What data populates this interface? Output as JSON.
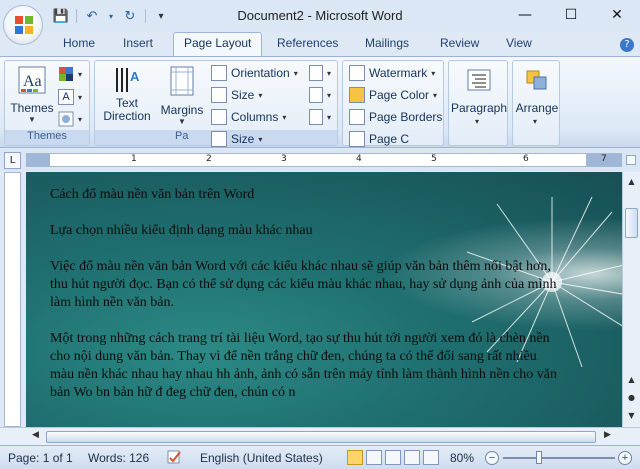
{
  "window": {
    "title": "Document2 - Microsoft Word",
    "minimize": "—",
    "maximize": "☐",
    "close": "✕"
  },
  "qat": {
    "save": "💾",
    "undo": "↶",
    "redo": "↻",
    "customize": "▾"
  },
  "tabs": [
    {
      "label": "Home"
    },
    {
      "label": "Insert"
    },
    {
      "label": "Page Layout"
    },
    {
      "label": "References"
    },
    {
      "label": "Mailings"
    },
    {
      "label": "Review"
    },
    {
      "label": "View"
    }
  ],
  "ribbon": {
    "themes": {
      "button": "Themes",
      "group": "Themes",
      "colors_icon": "theme-colors-icon",
      "fonts_icon": "A",
      "effects_icon": "theme-effects-icon"
    },
    "page_setup": {
      "text_direction": "Text Direction",
      "margins": "Margins",
      "orientation": "Orientation",
      "size": "Size",
      "columns": "Columns",
      "size2": "Size",
      "group_partial": "Pa"
    },
    "page_background": {
      "watermark": "Watermark",
      "page_color": "Page Color",
      "page_borders": "Page Borders",
      "page_c": "Page C"
    },
    "paragraph": "Paragraph",
    "arrange": "Arrange"
  },
  "ruler": {
    "numbers": [
      "1",
      "2",
      "3",
      "4",
      "5",
      "6",
      "7"
    ],
    "tab_selector": "L"
  },
  "document": {
    "paragraphs": [
      "Cách đổ màu nền văn bản trên Word",
      "Lựa chọn nhiều kiểu định dạng màu khác nhau",
      "Việc đổ màu nền văn bản Word với các kiểu khác nhau sẽ giúp văn bản thêm nổi bật hơn, thu hút người đọc. Bạn có thể sử dụng các kiểu màu khác nhau, hay sử dụng ảnh của mình làm hình nền văn bản.",
      "Một trong những cách trang trí tài liệu Word, tạo sự thu hút tới người xem đó là chèn nền cho nội dung văn bản. Thay vì để nền trắng chữ đen, chúng ta có thể đổi sang rất nhiều màu nền khác nhau hay nhau hh ảnh, ảnh có sẵn trên máy tính làm thành hình nền cho văn bản Wo bn bản hữ đ đeg chữ đen, chún có n"
    ]
  },
  "status": {
    "page": "Page: 1 of 1",
    "words": "Words: 126",
    "language": "English (United States)",
    "zoom": "80%",
    "zoom_minus": "−",
    "zoom_plus": "+",
    "zoom_level": 0.8
  },
  "colors": {
    "ribbon_bg": "#dde8f6",
    "page_teal": "#1f6f70",
    "accent": "#3a78c9"
  }
}
